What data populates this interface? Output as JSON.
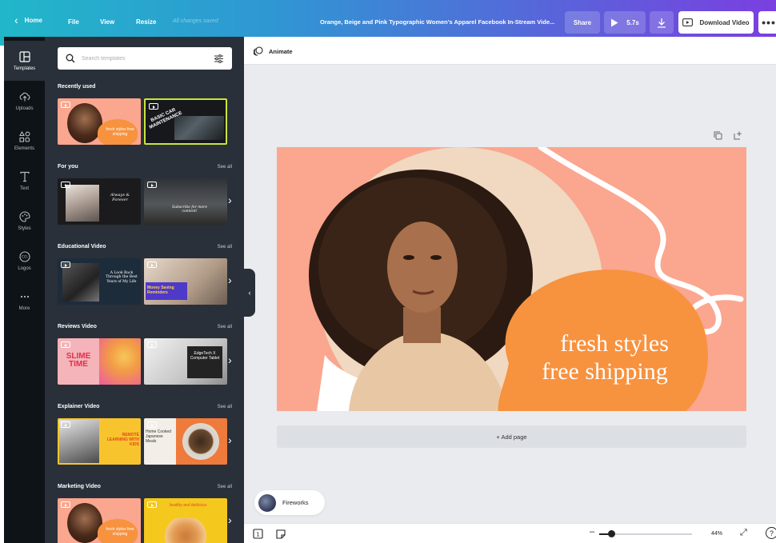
{
  "topbar": {
    "home": "Home",
    "file": "File",
    "view": "View",
    "resize": "Resize",
    "saved_status": "All changes saved",
    "doc_title": "Orange, Beige and Pink Typographic Women's Apparel Facebook In-Stream Vide...",
    "share": "Share",
    "duration": "5.7s",
    "download": "Download Video",
    "more": "•••"
  },
  "rail": [
    {
      "label": "Templates",
      "icon": "templates-icon"
    },
    {
      "label": "Uploads",
      "icon": "upload-cloud-icon"
    },
    {
      "label": "Elements",
      "icon": "shapes-icon"
    },
    {
      "label": "Text",
      "icon": "text-icon"
    },
    {
      "label": "Styles",
      "icon": "palette-icon"
    },
    {
      "label": "Logos",
      "icon": "logo-icon"
    },
    {
      "label": "More",
      "icon": "more-dots-icon"
    }
  ],
  "search": {
    "placeholder": "Search templates"
  },
  "sections": [
    {
      "title": "Recently used",
      "see_all": ""
    },
    {
      "title": "For you",
      "see_all": "See all"
    },
    {
      "title": "Educational Video",
      "see_all": "See all"
    },
    {
      "title": "Reviews Video",
      "see_all": "See all"
    },
    {
      "title": "Explainer Video",
      "see_all": "See all"
    },
    {
      "title": "Marketing Video",
      "see_all": "See all"
    }
  ],
  "thumbs": {
    "fresh": "fresh styles free shipping",
    "car": "BASIC CAR MAINTENANCE",
    "always": "Always & Forever",
    "subscribe": "Subscribe for more content!",
    "look_back": "A Look Back Through the Best Years of My Life",
    "money": "Money Saving Reminders",
    "slime": "SLIME TIME",
    "edgetech": "EdgeTech X Computer Tablet",
    "remote": "REMOTE LEARNING WITH KIDS",
    "japanese": "Home Cooked Japanese Meals",
    "healthy": "healthy and delicious"
  },
  "editor": {
    "animate": "Animate",
    "add_page": "+ Add page",
    "fireworks": "Fireworks",
    "zoom": "44%",
    "help": "?"
  },
  "canvas": {
    "line1": "fresh styles",
    "line2": "free shipping"
  },
  "colors": {
    "canvas_bg": "#fba68f",
    "blob_orange": "#f7923f",
    "panel_bg": "#293039",
    "rail_bg": "#0e1318"
  }
}
